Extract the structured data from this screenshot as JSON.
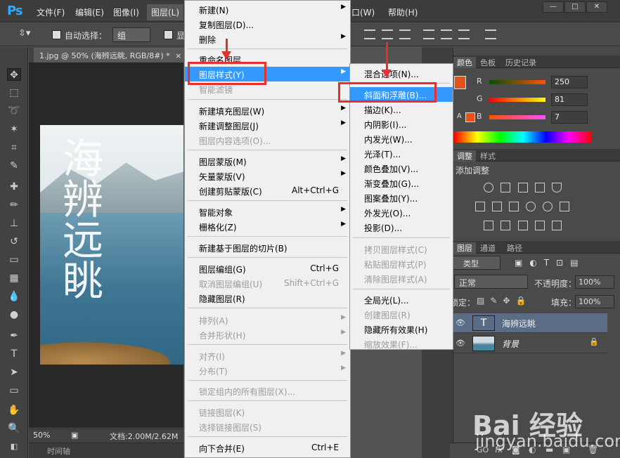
{
  "app": {
    "logo": "Ps",
    "menubar": [
      "文件(F)",
      "编辑(E)",
      "图像(I)",
      "图层(L)",
      "口(W)",
      "帮助(H)"
    ],
    "window_buttons": [
      "—",
      "□",
      "✕"
    ]
  },
  "options_bar": {
    "auto_select_label": "自动选择：",
    "auto_select_value": "组",
    "show_label": "显"
  },
  "document": {
    "tab_title": "1.jpg @ 50% (海辨远眺, RGB/8#) *",
    "tab_close": "×",
    "watermark_text": "海辨远眺",
    "zoom": "50%",
    "doc_info": "文档:2.00M/2.62M",
    "timeline": "时间轴"
  },
  "layer_menu": {
    "items": [
      {
        "label": "新建(N)",
        "submenu": true
      },
      {
        "label": "复制图层(D)..."
      },
      {
        "label": "删除",
        "submenu": true
      },
      {
        "label": "重命名图层..."
      },
      {
        "label": "图层样式(Y)",
        "submenu": true,
        "highlight": true
      },
      {
        "label": "智能滤镜",
        "disabled": true
      },
      {
        "label": "新建填充图层(W)",
        "submenu": true
      },
      {
        "label": "新建调整图层(J)",
        "submenu": true
      },
      {
        "label": "图层内容选项(O)...",
        "disabled": true
      },
      {
        "label": "图层蒙版(M)",
        "submenu": true
      },
      {
        "label": "矢量蒙版(V)",
        "submenu": true
      },
      {
        "label": "创建剪贴蒙版(C)",
        "shortcut": "Alt+Ctrl+G"
      },
      {
        "label": "智能对象",
        "submenu": true
      },
      {
        "label": "栅格化(Z)",
        "submenu": true
      },
      {
        "label": "新建基于图层的切片(B)"
      },
      {
        "label": "图层编组(G)",
        "shortcut": "Ctrl+G"
      },
      {
        "label": "取消图层编组(U)",
        "shortcut": "Shift+Ctrl+G",
        "disabled": true
      },
      {
        "label": "隐藏图层(R)"
      },
      {
        "label": "排列(A)",
        "submenu": true,
        "disabled": true
      },
      {
        "label": "合并形状(H)",
        "submenu": true,
        "disabled": true
      },
      {
        "label": "对齐(I)",
        "submenu": true,
        "disabled": true
      },
      {
        "label": "分布(T)",
        "submenu": true,
        "disabled": true
      },
      {
        "label": "锁定组内的所有图层(X)...",
        "disabled": true
      },
      {
        "label": "链接图层(K)",
        "disabled": true
      },
      {
        "label": "选择链接图层(S)",
        "disabled": true
      },
      {
        "label": "向下合并(E)",
        "shortcut": "Ctrl+E"
      }
    ]
  },
  "style_submenu": {
    "items": [
      {
        "label": "混合选项(N)..."
      },
      {
        "label": "斜面和浮雕(B)...",
        "highlight": true
      },
      {
        "label": "描边(K)..."
      },
      {
        "label": "内阴影(I)..."
      },
      {
        "label": "内发光(W)..."
      },
      {
        "label": "光泽(T)..."
      },
      {
        "label": "颜色叠加(V)..."
      },
      {
        "label": "渐变叠加(G)..."
      },
      {
        "label": "图案叠加(Y)..."
      },
      {
        "label": "外发光(O)..."
      },
      {
        "label": "投影(D)..."
      },
      {
        "label": "拷贝图层样式(C)",
        "disabled": true
      },
      {
        "label": "粘贴图层样式(P)",
        "disabled": true
      },
      {
        "label": "清除图层样式(A)",
        "disabled": true
      },
      {
        "label": "全局光(L)..."
      },
      {
        "label": "创建图层(R)",
        "disabled": true
      },
      {
        "label": "隐藏所有效果(H)"
      },
      {
        "label": "缩放效果(F)...",
        "disabled": true
      }
    ]
  },
  "color_panel": {
    "tabs": [
      "颜色",
      "色板",
      "历史记录"
    ],
    "foreground": "#e8501c",
    "r": {
      "label": "R",
      "value": "250"
    },
    "g": {
      "label": "G",
      "value": "81"
    },
    "b": {
      "label": "B",
      "value": "7"
    }
  },
  "adjust_panel": {
    "tabs": [
      "调整",
      "样式"
    ],
    "title": "添加调整"
  },
  "layers_panel": {
    "tabs": [
      "图层",
      "通道",
      "路径"
    ],
    "filter_label": "类型",
    "blend_mode": "正常",
    "opacity_label": "不透明度：",
    "opacity_value": "100%",
    "lock_label": "锁定：",
    "fill_label": "填充：",
    "fill_value": "100%",
    "layers": [
      {
        "name": "海辨远眺",
        "type": "text",
        "thumb": "T",
        "selected": true
      },
      {
        "name": "背景",
        "type": "image",
        "locked": true
      }
    ],
    "footer_icons": [
      "GO",
      "fx"
    ]
  },
  "watermark": {
    "brand": "Bai 经验",
    "site": "jingyan.baidu.com"
  }
}
